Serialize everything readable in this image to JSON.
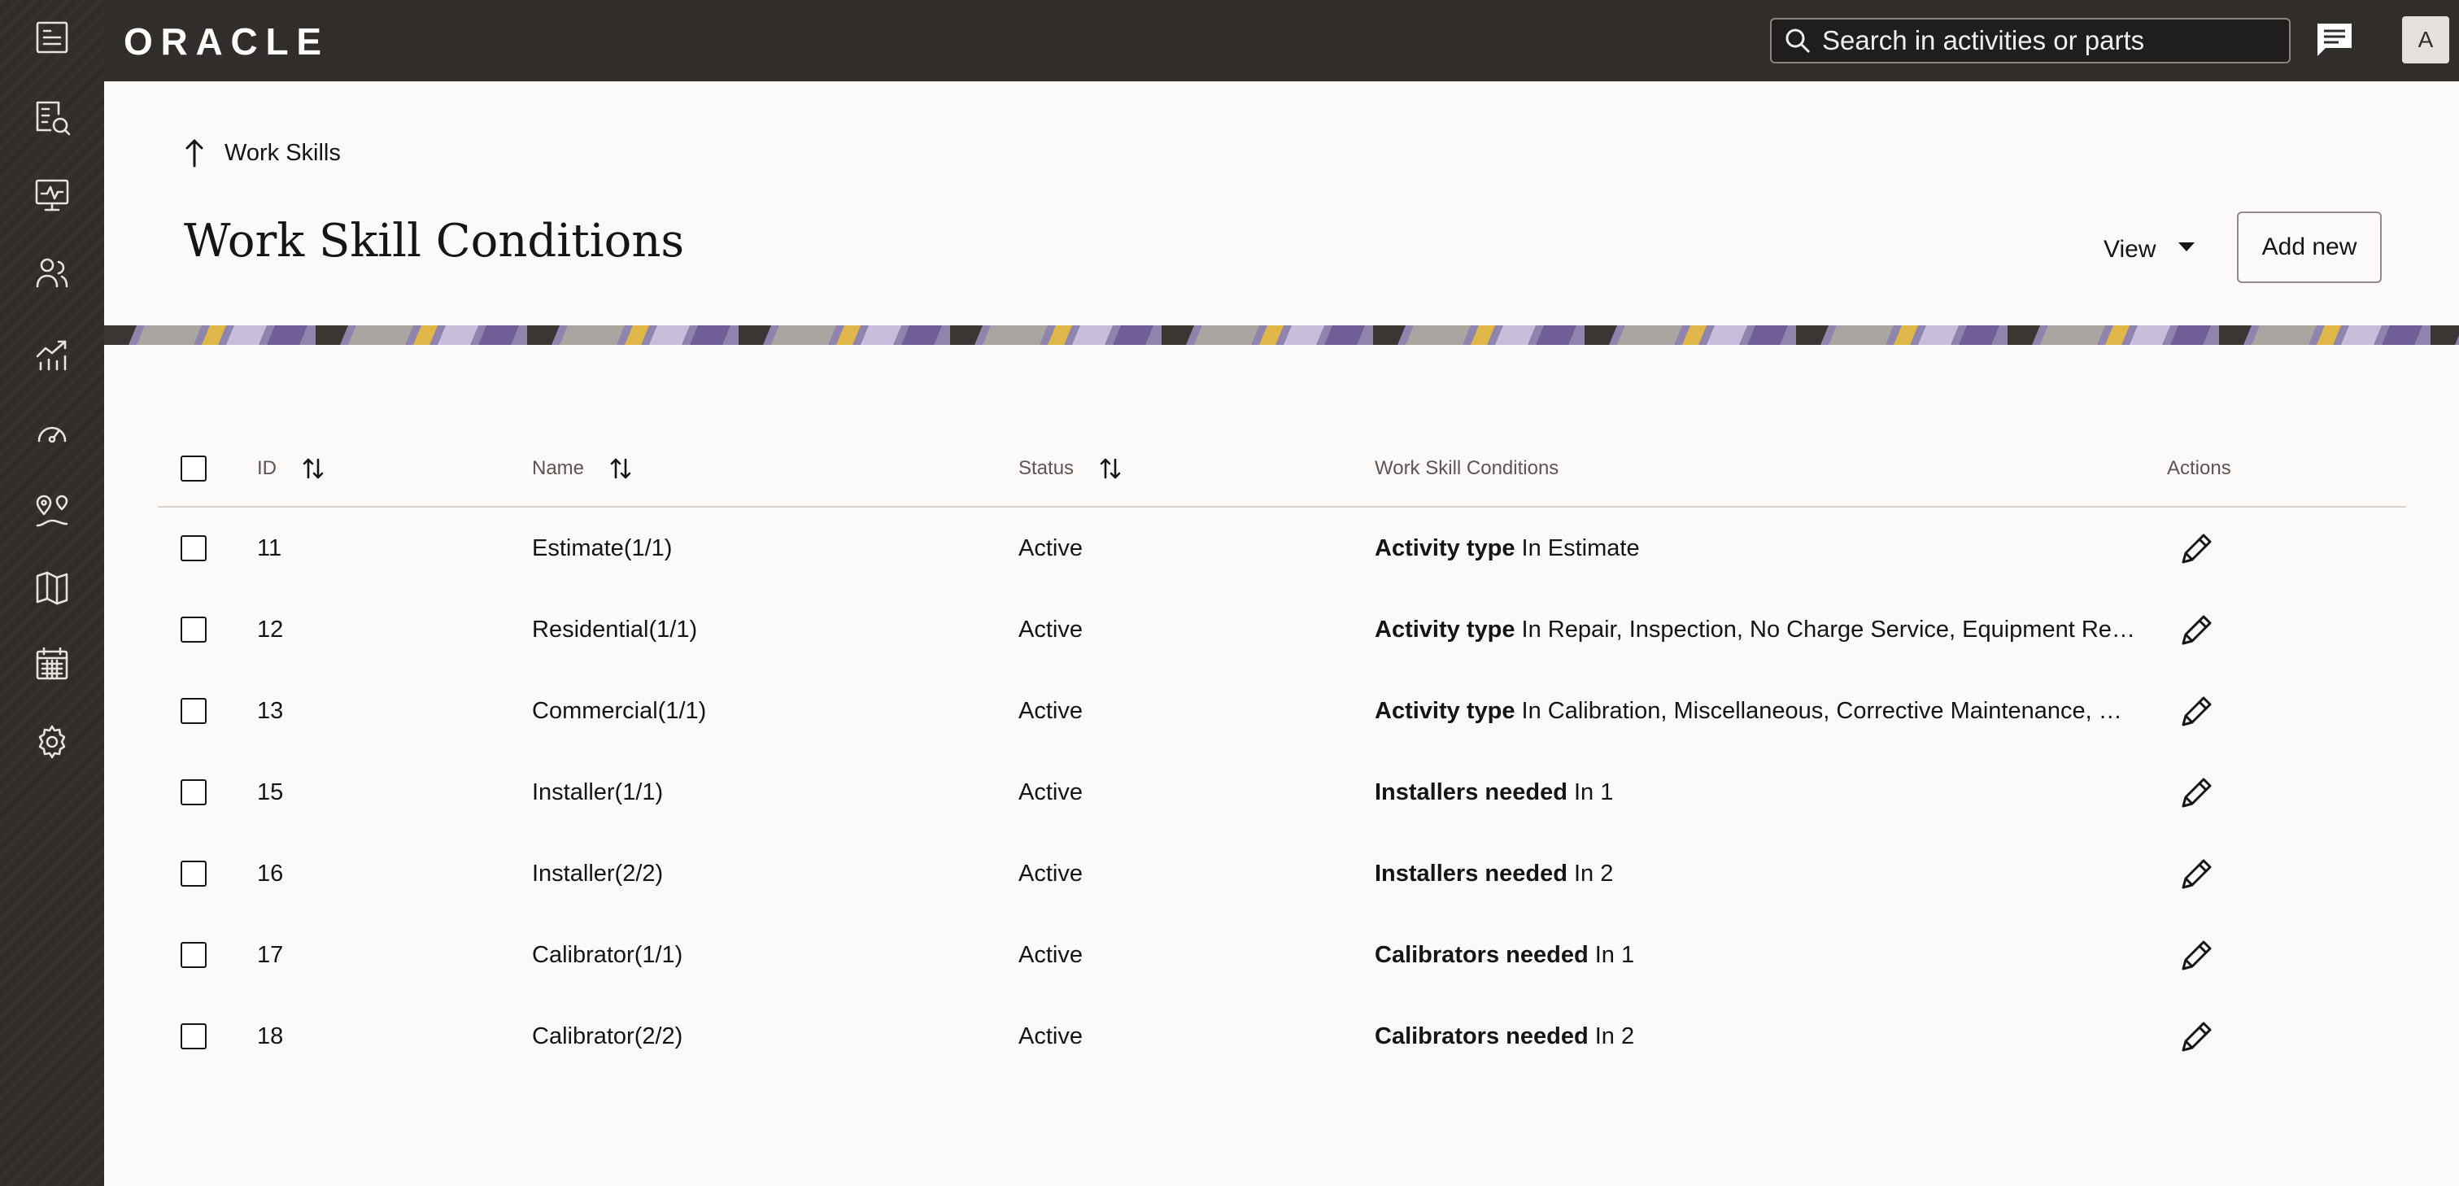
{
  "header": {
    "logo_text": "ORACLE",
    "search_placeholder": "Search in activities or parts",
    "avatar_initial": "A"
  },
  "nav": {
    "icons": [
      "dispatch-console-icon",
      "activity-list-icon",
      "monitor-icon",
      "resources-icon",
      "analytics-icon",
      "dashboard-icon",
      "routing-icon",
      "map-icon",
      "calendar-icon",
      "settings-icon"
    ]
  },
  "page": {
    "back_label": "Work Skills",
    "title": "Work Skill Conditions",
    "view_label": "View",
    "add_new_label": "Add new"
  },
  "table": {
    "columns": {
      "id": "ID",
      "name": "Name",
      "status": "Status",
      "conditions": "Work Skill Conditions",
      "actions": "Actions"
    },
    "rows": [
      {
        "id": "11",
        "name": "Estimate(1/1)",
        "status": "Active",
        "cond_field": "Activity type",
        "cond_value": "In Estimate"
      },
      {
        "id": "12",
        "name": "Residential(1/1)",
        "status": "Active",
        "cond_field": "Activity type",
        "cond_value": "In Repair, Inspection, No Charge Service, Equipment Re…"
      },
      {
        "id": "13",
        "name": "Commercial(1/1)",
        "status": "Active",
        "cond_field": "Activity type",
        "cond_value": "In Calibration, Miscellaneous, Corrective Maintenance, …"
      },
      {
        "id": "15",
        "name": "Installer(1/1)",
        "status": "Active",
        "cond_field": "Installers needed",
        "cond_value": "In 1"
      },
      {
        "id": "16",
        "name": "Installer(2/2)",
        "status": "Active",
        "cond_field": "Installers needed",
        "cond_value": "In 2"
      },
      {
        "id": "17",
        "name": "Calibrator(1/1)",
        "status": "Active",
        "cond_field": "Calibrators needed",
        "cond_value": "In 1"
      },
      {
        "id": "18",
        "name": "Calibrator(2/2)",
        "status": "Active",
        "cond_field": "Calibrators needed",
        "cond_value": "In 2"
      }
    ]
  },
  "colors": {
    "header_bg": "#312d2a",
    "rail_bg": "#2f2c2a",
    "page_bg": "#fbfaf8",
    "text": "#161513"
  }
}
